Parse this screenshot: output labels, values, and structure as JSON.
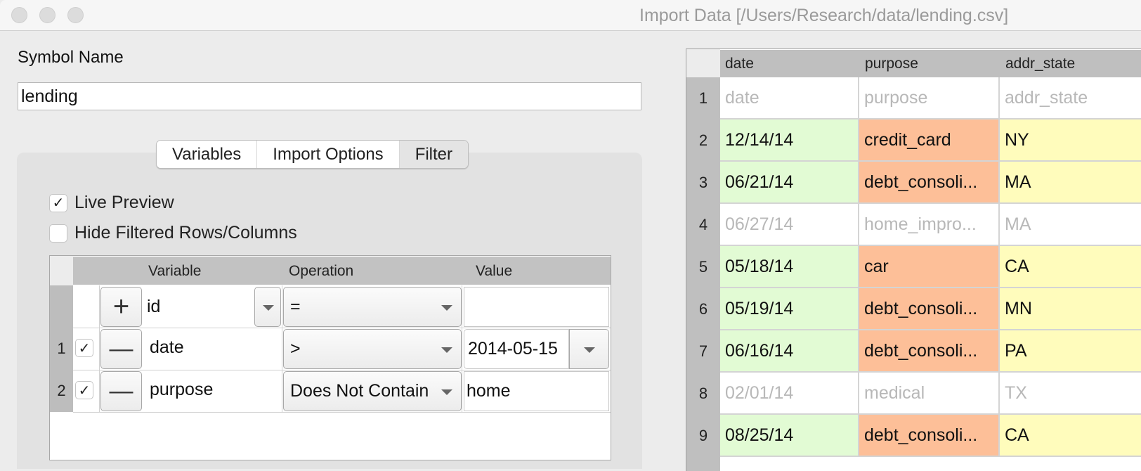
{
  "window": {
    "title": "Import Data [/Users/Research/data/lending.csv]",
    "buttons": [
      "close",
      "minimize",
      "zoom"
    ]
  },
  "symbol": {
    "label": "Symbol Name",
    "value": "lending"
  },
  "tabs": [
    {
      "label": "Variables",
      "active": false
    },
    {
      "label": "Import Options",
      "active": false
    },
    {
      "label": "Filter",
      "active": true
    }
  ],
  "filter": {
    "live_preview": {
      "label": "Live Preview",
      "checked": true
    },
    "hide_filtered": {
      "label": "Hide Filtered Rows/Columns",
      "checked": false
    },
    "columns": {
      "variable": "Variable",
      "operation": "Operation",
      "value": "Value"
    },
    "new_row": {
      "variable": "id",
      "operation": "=",
      "value": "",
      "add_icon": "plus-icon"
    },
    "rows": [
      {
        "num": "1",
        "enabled": true,
        "variable": "date",
        "operation": ">",
        "value": "2014-05-15",
        "remove_icon": "minus-icon"
      },
      {
        "num": "2",
        "enabled": true,
        "variable": "purpose",
        "operation": "Does Not Contain",
        "value": "home",
        "remove_icon": "minus-icon"
      }
    ]
  },
  "preview": {
    "columns": [
      "date",
      "purpose",
      "addr_state"
    ],
    "colors": {
      "date": "#e2fbd4",
      "purpose": "#fdbf98",
      "addr_state": "#fffcbc",
      "excluded_text": "#b8b8b8"
    },
    "rows": [
      {
        "num": "1",
        "cells": [
          "date",
          "purpose",
          "addr_state"
        ],
        "excluded": true
      },
      {
        "num": "2",
        "cells": [
          "12/14/14",
          "credit_card",
          "NY"
        ],
        "excluded": false
      },
      {
        "num": "3",
        "cells": [
          "06/21/14",
          "debt_consoli...",
          "MA"
        ],
        "excluded": false
      },
      {
        "num": "4",
        "cells": [
          "06/27/14",
          "home_impro...",
          "MA"
        ],
        "excluded": true
      },
      {
        "num": "5",
        "cells": [
          "05/18/14",
          "car",
          "CA"
        ],
        "excluded": false
      },
      {
        "num": "6",
        "cells": [
          "05/19/14",
          "debt_consoli...",
          "MN"
        ],
        "excluded": false
      },
      {
        "num": "7",
        "cells": [
          "06/16/14",
          "debt_consoli...",
          "PA"
        ],
        "excluded": false
      },
      {
        "num": "8",
        "cells": [
          "02/01/14",
          "medical",
          "TX"
        ],
        "excluded": true
      },
      {
        "num": "9",
        "cells": [
          "08/25/14",
          "debt_consoli...",
          "CA"
        ],
        "excluded": false
      }
    ]
  }
}
